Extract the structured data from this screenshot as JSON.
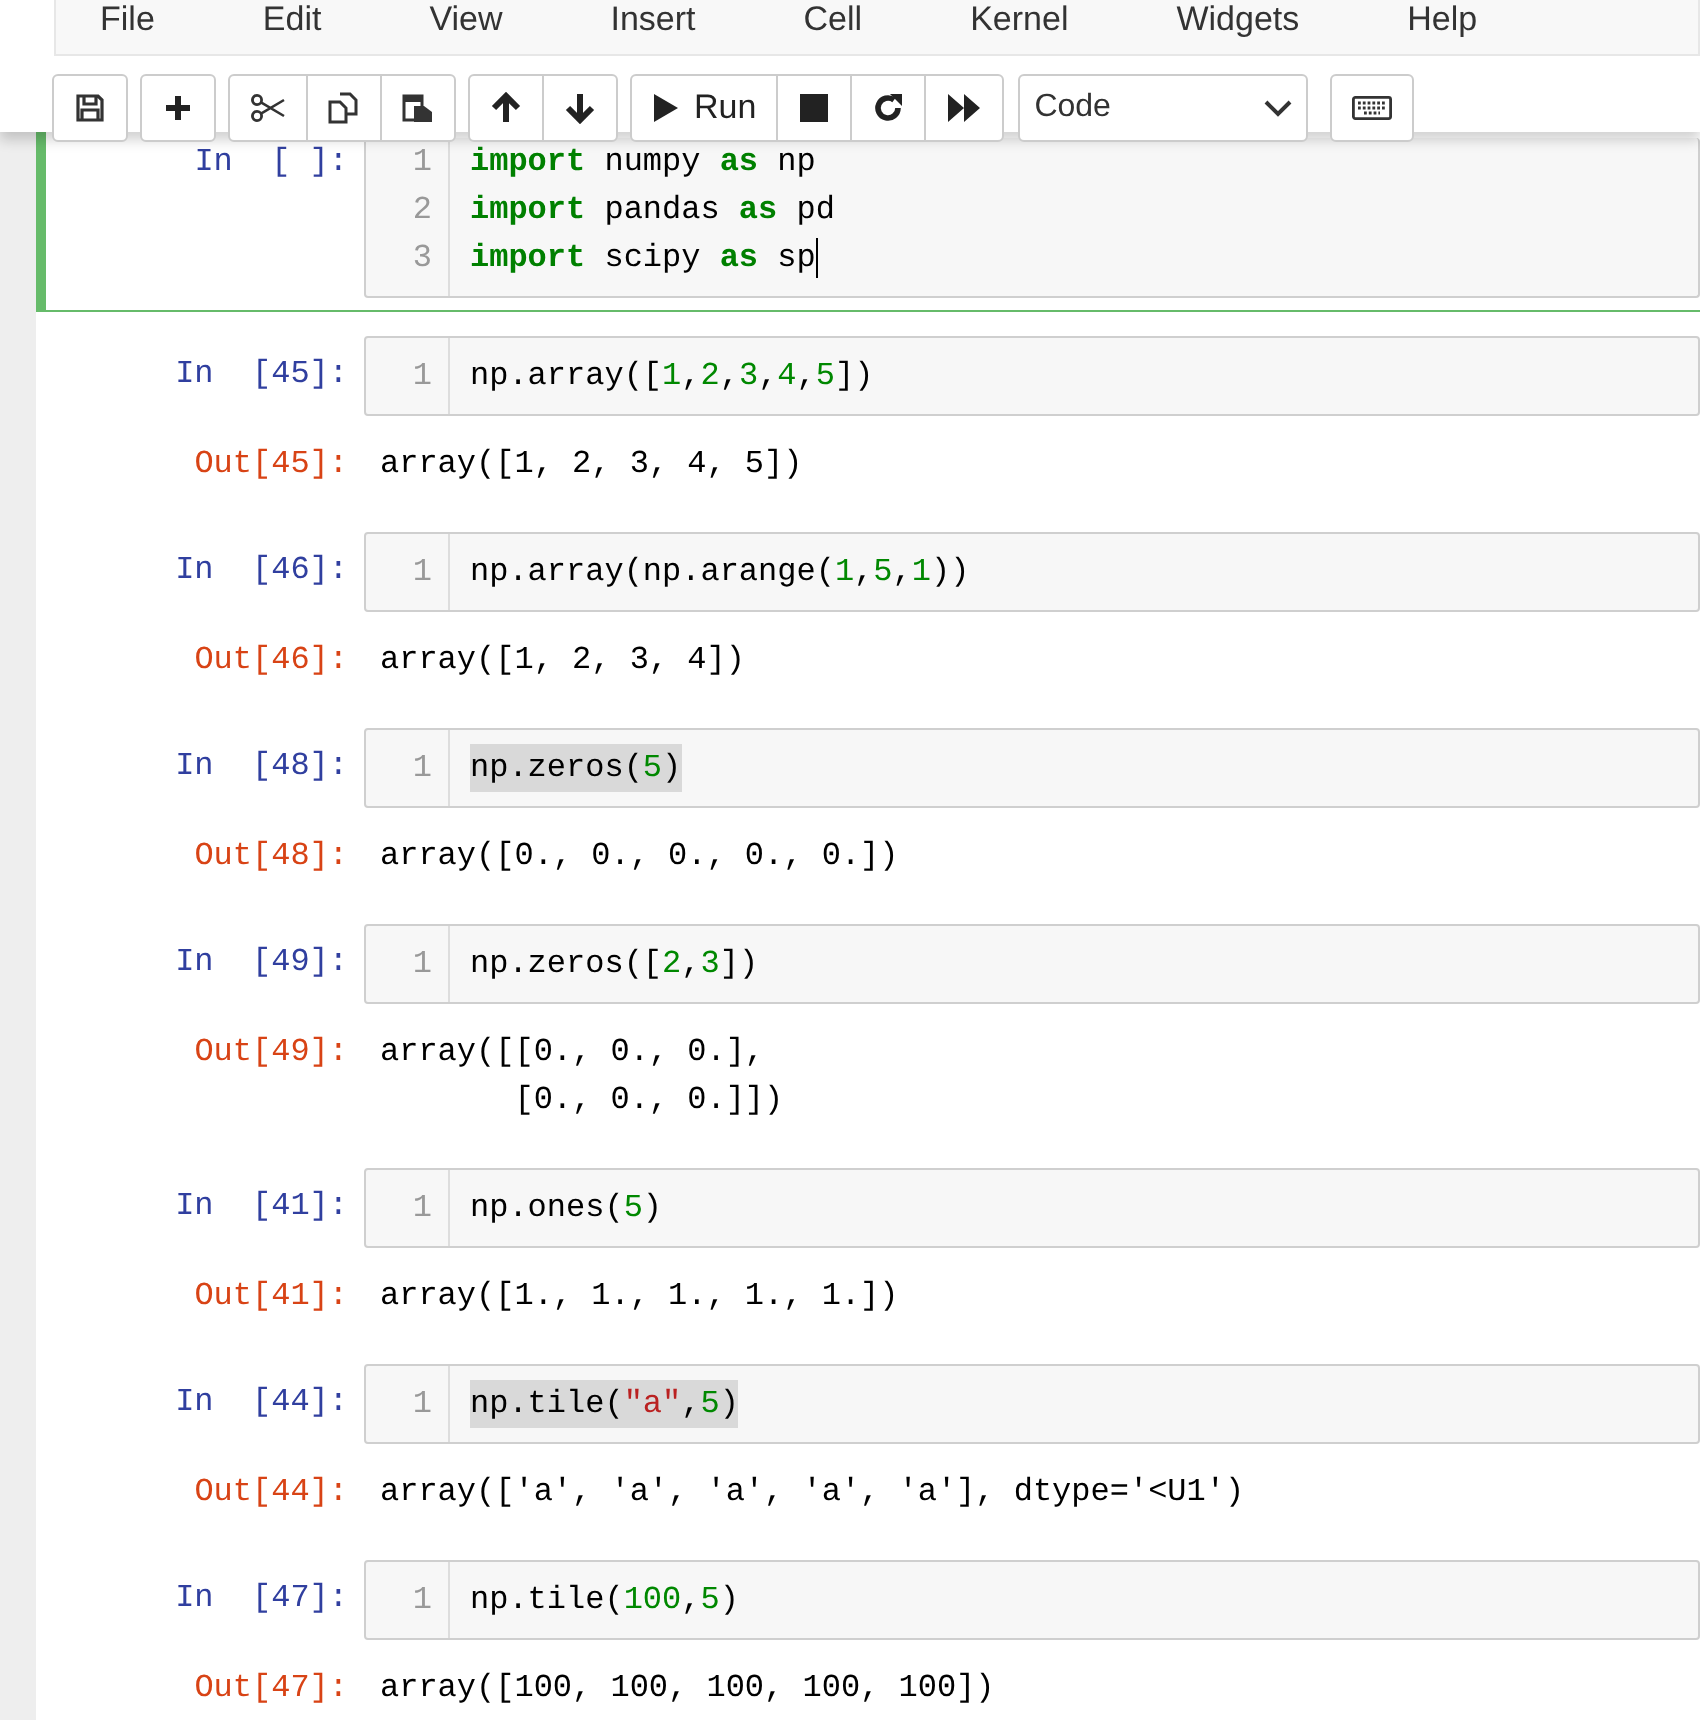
{
  "menu": [
    "File",
    "Edit",
    "View",
    "Insert",
    "Cell",
    "Kernel",
    "Widgets",
    "Help"
  ],
  "toolbar": [
    [
      {
        "kind": "save"
      }
    ],
    [
      {
        "kind": "add"
      }
    ],
    [
      {
        "kind": "cut"
      },
      {
        "kind": "copy"
      },
      {
        "kind": "paste"
      }
    ],
    [
      {
        "kind": "up"
      },
      {
        "kind": "down"
      }
    ],
    [
      {
        "kind": "run",
        "label": "Run"
      },
      {
        "kind": "stop"
      },
      {
        "kind": "restart"
      },
      {
        "kind": "fastforward"
      }
    ]
  ],
  "cell_type": "Code",
  "keyboard_button": {
    "kind": "keyboard"
  },
  "cells": [
    {
      "prompt": "In  [ ]:",
      "selected": true,
      "lines": [
        {
          "number": "1",
          "tokens": [
            {
              "kind": "keyword",
              "text": "import"
            },
            {
              "kind": "name",
              "text": " numpy "
            },
            {
              "kind": "keyword",
              "text": "as"
            },
            {
              "kind": "name",
              "text": " np"
            }
          ]
        },
        {
          "number": "2",
          "tokens": [
            {
              "kind": "keyword",
              "text": "import"
            },
            {
              "kind": "name",
              "text": " pandas "
            },
            {
              "kind": "keyword",
              "text": "as"
            },
            {
              "kind": "name",
              "text": " pd"
            }
          ]
        },
        {
          "number": "3",
          "cursor": true,
          "tokens": [
            {
              "kind": "keyword",
              "text": "import"
            },
            {
              "kind": "name",
              "text": " scipy "
            },
            {
              "kind": "keyword",
              "text": "as"
            },
            {
              "kind": "name",
              "text": " sp"
            }
          ]
        }
      ]
    },
    {
      "prompt": "In  [45]:",
      "selected": false,
      "lines": [
        {
          "number": "1",
          "tokens": [
            {
              "kind": "name",
              "text": "np.array(["
            },
            {
              "kind": "number",
              "text": "1"
            },
            {
              "kind": "name",
              "text": ","
            },
            {
              "kind": "number",
              "text": "2"
            },
            {
              "kind": "name",
              "text": ","
            },
            {
              "kind": "number",
              "text": "3"
            },
            {
              "kind": "name",
              "text": ","
            },
            {
              "kind": "number",
              "text": "4"
            },
            {
              "kind": "name",
              "text": ","
            },
            {
              "kind": "number",
              "text": "5"
            },
            {
              "kind": "name",
              "text": "])"
            }
          ]
        }
      ],
      "out_prompt": "Out[45]:",
      "output": [
        "array([1, 2, 3, 4, 5])"
      ]
    },
    {
      "prompt": "In  [46]:",
      "selected": false,
      "lines": [
        {
          "number": "1",
          "tokens": [
            {
              "kind": "name",
              "text": "np.array(np.arange("
            },
            {
              "kind": "number",
              "text": "1"
            },
            {
              "kind": "name",
              "text": ","
            },
            {
              "kind": "number",
              "text": "5"
            },
            {
              "kind": "name",
              "text": ","
            },
            {
              "kind": "number",
              "text": "1"
            },
            {
              "kind": "name",
              "text": "))"
            }
          ]
        }
      ],
      "out_prompt": "Out[46]:",
      "output": [
        "array([1, 2, 3, 4])"
      ]
    },
    {
      "prompt": "In  [48]:",
      "selected": false,
      "lines": [
        {
          "number": "1",
          "highlighted": true,
          "tokens": [
            {
              "kind": "name",
              "text": "np.zeros("
            },
            {
              "kind": "number",
              "text": "5"
            },
            {
              "kind": "name",
              "text": ")"
            }
          ]
        }
      ],
      "out_prompt": "Out[48]:",
      "output": [
        "array([0., 0., 0., 0., 0.])"
      ]
    },
    {
      "prompt": "In  [49]:",
      "selected": false,
      "lines": [
        {
          "number": "1",
          "tokens": [
            {
              "kind": "name",
              "text": "np.zeros(["
            },
            {
              "kind": "number",
              "text": "2"
            },
            {
              "kind": "name",
              "text": ","
            },
            {
              "kind": "number",
              "text": "3"
            },
            {
              "kind": "name",
              "text": "])"
            }
          ]
        }
      ],
      "out_prompt": "Out[49]:",
      "output": [
        "array([[0., 0., 0.],",
        "       [0., 0., 0.]])"
      ]
    },
    {
      "prompt": "In  [41]:",
      "selected": false,
      "lines": [
        {
          "number": "1",
          "tokens": [
            {
              "kind": "name",
              "text": "np.ones("
            },
            {
              "kind": "number",
              "text": "5"
            },
            {
              "kind": "name",
              "text": ")"
            }
          ]
        }
      ],
      "out_prompt": "Out[41]:",
      "output": [
        "array([1., 1., 1., 1., 1.])"
      ]
    },
    {
      "prompt": "In  [44]:",
      "selected": false,
      "lines": [
        {
          "number": "1",
          "highlighted": true,
          "tokens": [
            {
              "kind": "name",
              "text": "np.tile("
            },
            {
              "kind": "string",
              "text": "\"a\""
            },
            {
              "kind": "name",
              "text": ","
            },
            {
              "kind": "number",
              "text": "5"
            },
            {
              "kind": "name",
              "text": ")"
            }
          ]
        }
      ],
      "out_prompt": "Out[44]:",
      "output": [
        "array(['a', 'a', 'a', 'a', 'a'], dtype='<U1')"
      ]
    },
    {
      "prompt": "In  [47]:",
      "selected": false,
      "lines": [
        {
          "number": "1",
          "tokens": [
            {
              "kind": "name",
              "text": "np.tile("
            },
            {
              "kind": "number",
              "text": "100"
            },
            {
              "kind": "name",
              "text": ","
            },
            {
              "kind": "number",
              "text": "5"
            },
            {
              "kind": "name",
              "text": ")"
            }
          ]
        }
      ],
      "out_prompt": "Out[47]:",
      "output": [
        "array([100, 100, 100, 100, 100])"
      ]
    }
  ]
}
